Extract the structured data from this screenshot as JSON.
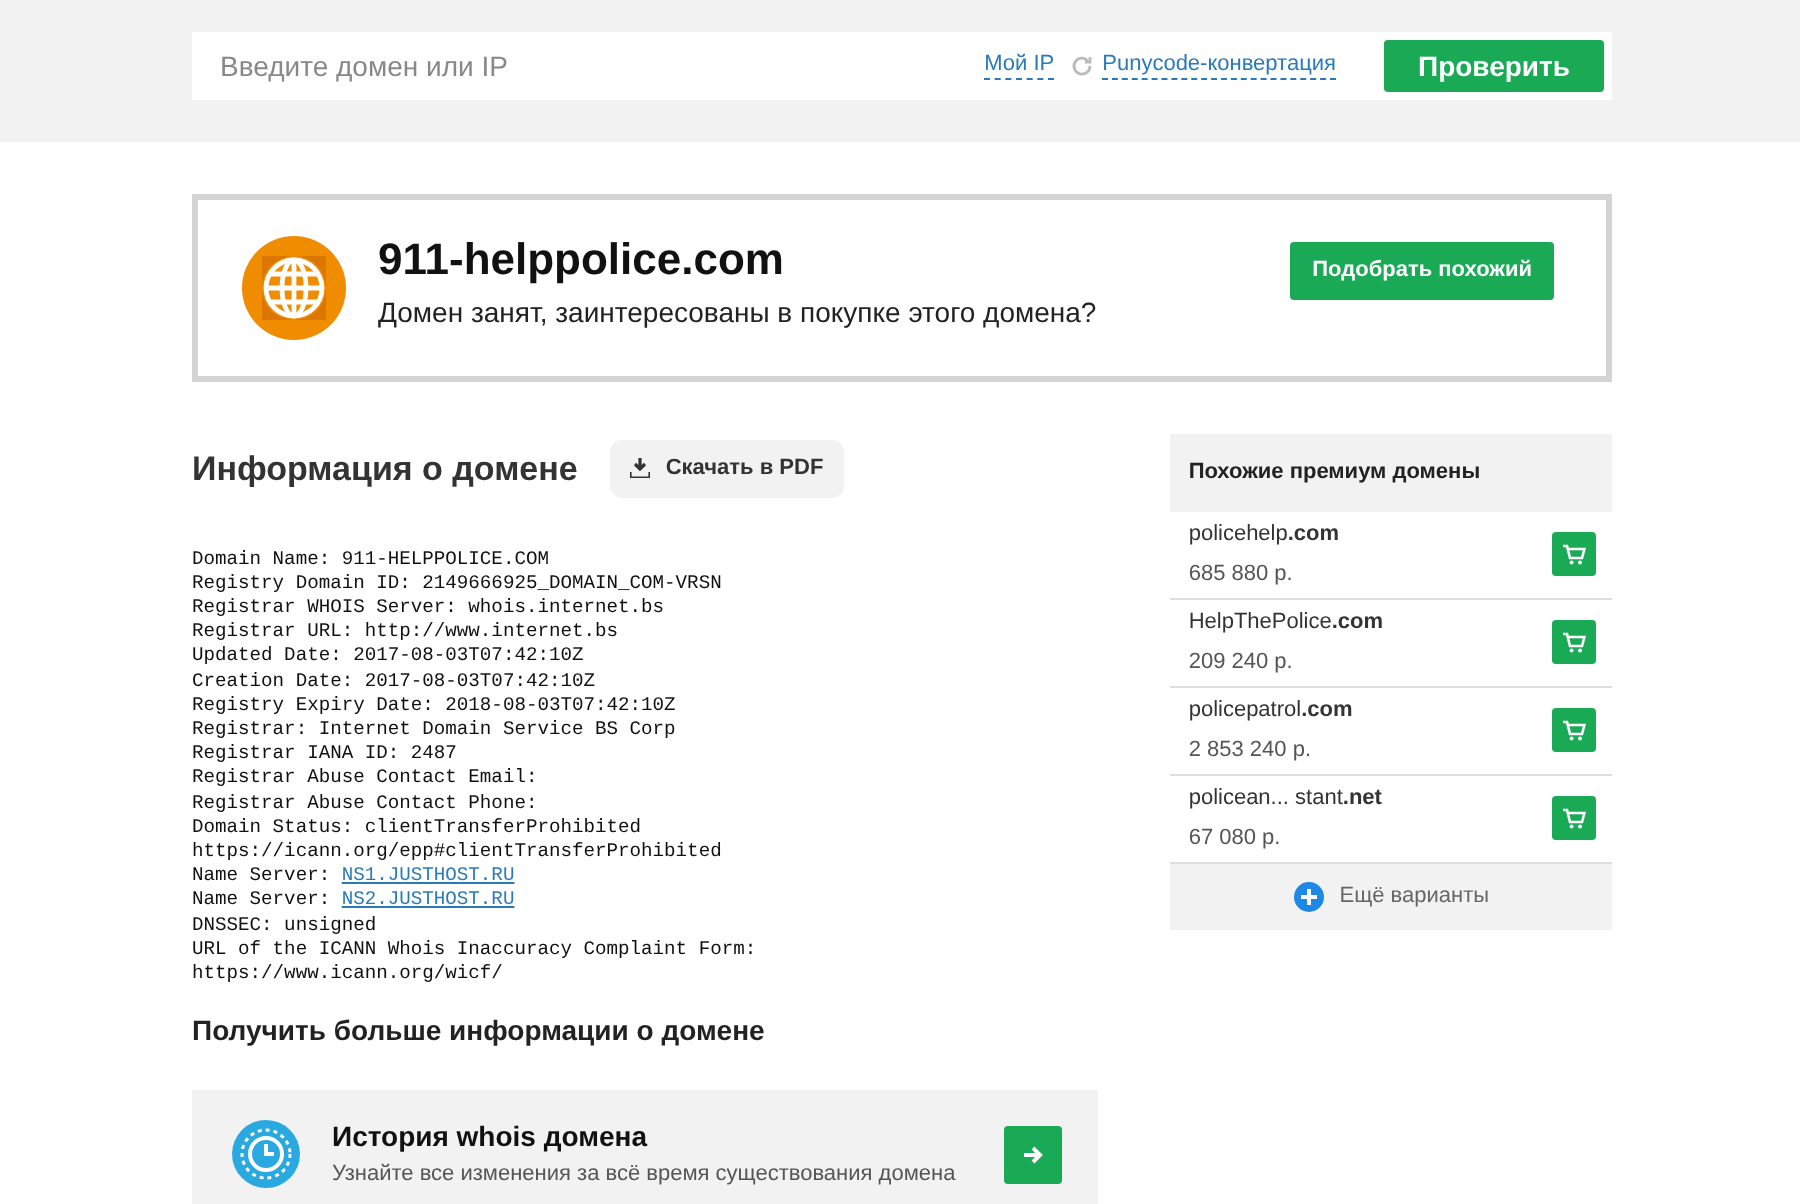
{
  "search": {
    "placeholder": "Введите домен или IP",
    "links": [
      "Мой IP",
      "Punycode-конвертация"
    ],
    "button": "Проверить"
  },
  "domain_card": {
    "domain": "911-helppolice.com",
    "message": "Домен занят, заинтересованы в покупке этого домена?",
    "button": "Подобрать похожий"
  },
  "info": {
    "title": "Информация о домене",
    "pdf_button": "Скачать в PDF",
    "whois_lines": [
      {
        "text": "Domain Name: 911-HELPPOLICE.COM"
      },
      {
        "text": "Registry Domain ID: 2149666925_DOMAIN_COM-VRSN"
      },
      {
        "text": "Registrar WHOIS Server: whois.internet.bs"
      },
      {
        "text": "Registrar URL: http://www.internet.bs"
      },
      {
        "text": "Updated Date: 2017-08-03T07:42:10Z"
      },
      {
        "text": "Creation Date: 2017-08-03T07:42:10Z"
      },
      {
        "text": "Registry Expiry Date: 2018-08-03T07:42:10Z"
      },
      {
        "text": "Registrar: Internet Domain Service BS Corp"
      },
      {
        "text": "Registrar IANA ID: 2487"
      },
      {
        "text": "Registrar Abuse Contact Email:"
      },
      {
        "text": "Registrar Abuse Contact Phone:"
      },
      {
        "text": "Domain Status: clientTransferProhibited"
      },
      {
        "text": "https://icann.org/epp#clientTransferProhibited"
      },
      {
        "text": "Name Server: ",
        "link": "NS1.JUSTHOST.RU"
      },
      {
        "text": "Name Server: ",
        "link": "NS2.JUSTHOST.RU"
      },
      {
        "text": "DNSSEC: unsigned"
      },
      {
        "text": "URL of the ICANN Whois Inaccuracy Complaint Form:"
      },
      {
        "text": "https://www.icann.org/wicf/"
      }
    ]
  },
  "more_info": {
    "title": "Получить больше информации о домене",
    "card_title": "История whois домена",
    "card_text": "Узнайте все изменения за всё время существования домена"
  },
  "premium": {
    "title": "Похожие премиум домены",
    "items": [
      {
        "name": "policehelp**.com**",
        "price": "685 880 р."
      },
      {
        "name": "HelpThePolice**.com**",
        "price": "209 240 р."
      },
      {
        "name": "policepatrol**.com**",
        "price": "2 853 240 р."
      },
      {
        "name": "policean... stant**.net**",
        "price": "67 080 р."
      }
    ],
    "more": "Ещё варианты"
  }
}
